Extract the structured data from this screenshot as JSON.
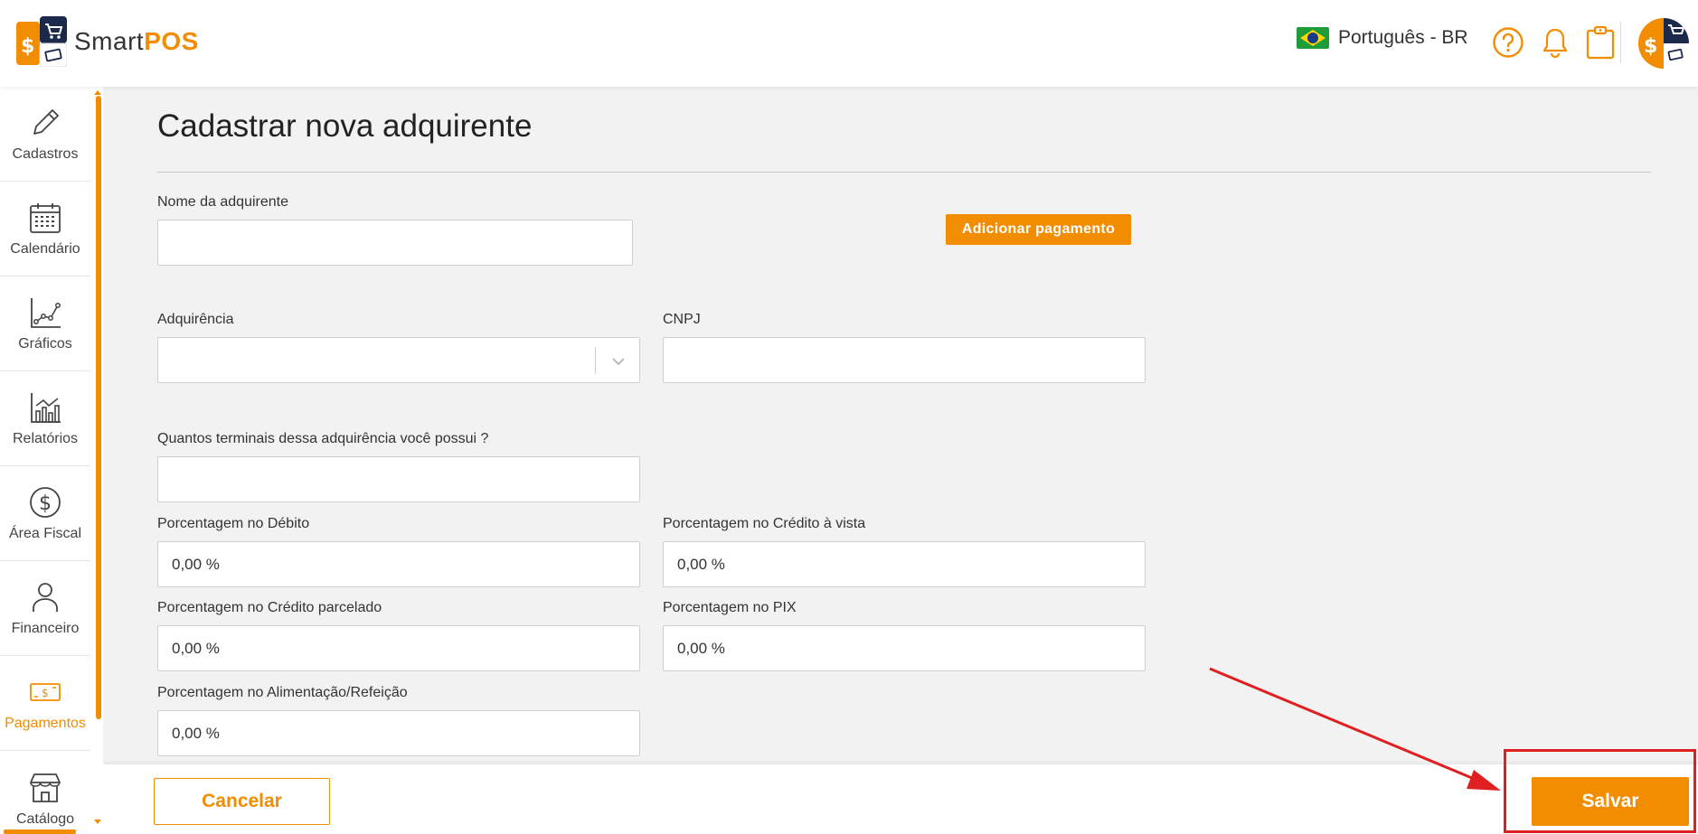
{
  "header": {
    "logo_text_a": "Smart",
    "logo_text_b": "POS",
    "language": "Português - BR",
    "icons": [
      "help-icon",
      "bell-icon",
      "clipboard-icon"
    ]
  },
  "sidebar": {
    "items": [
      {
        "label": "Cadastros",
        "icon": "pencil-icon"
      },
      {
        "label": "Calendário",
        "icon": "calendar-icon"
      },
      {
        "label": "Gráficos",
        "icon": "line-chart-icon"
      },
      {
        "label": "Relatórios",
        "icon": "bar-chart-icon"
      },
      {
        "label": "Área Fiscal",
        "icon": "dollar-circle-icon"
      },
      {
        "label": "Financeiro",
        "icon": "person-icon"
      },
      {
        "label": "Pagamentos",
        "icon": "banknote-icon",
        "active": true
      },
      {
        "label": "Catálogo",
        "icon": "store-icon"
      }
    ]
  },
  "form": {
    "title": "Cadastrar nova adquirente",
    "nome_label": "Nome da adquirente",
    "nome_value": "",
    "add_payment_label": "Adicionar pagamento",
    "adquirencia_label": "Adquirência",
    "adquirencia_value": "",
    "cnpj_label": "CNPJ",
    "cnpj_value": "",
    "terminais_label": "Quantos terminais dessa adquirência você possui ?",
    "terminais_value": "",
    "debito_label": "Porcentagem no Débito",
    "debito_value": "0,00 %",
    "credito_vista_label": "Porcentagem no Crédito à vista",
    "credito_vista_value": "0,00 %",
    "credito_parcelado_label": "Porcentagem no Crédito parcelado",
    "credito_parcelado_value": "0,00 %",
    "pix_label": "Porcentagem no PIX",
    "pix_value": "0,00 %",
    "alimentacao_label": "Porcentagem no Alimentação/Refeição",
    "alimentacao_value": "0,00 %"
  },
  "footer": {
    "cancel_label": "Cancelar",
    "save_label": "Salvar"
  },
  "colors": {
    "accent": "#f28c00",
    "annotation": "#e02020"
  }
}
